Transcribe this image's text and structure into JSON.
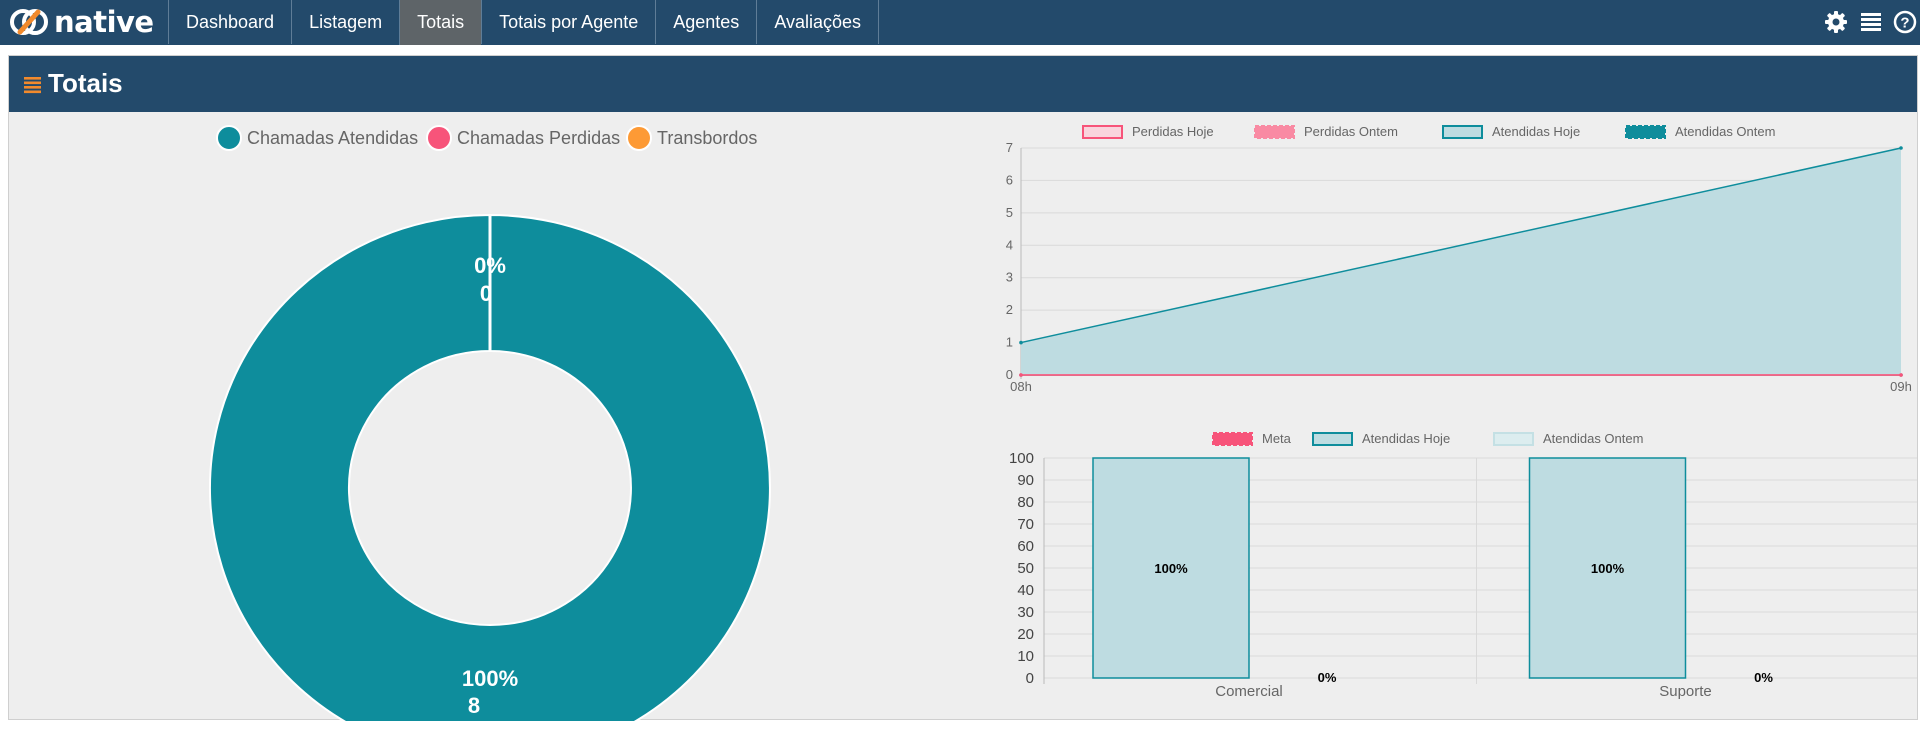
{
  "brand": {
    "name": "native"
  },
  "nav": {
    "items": [
      {
        "label": "Dashboard"
      },
      {
        "label": "Listagem"
      },
      {
        "label": "Totais"
      },
      {
        "label": "Totais por Agente"
      },
      {
        "label": "Agentes"
      },
      {
        "label": "Avaliações"
      }
    ],
    "active_index": 2
  },
  "toolbar": {
    "icons": [
      "gear-icon",
      "list-icon",
      "help-icon"
    ]
  },
  "panel": {
    "title": "Totais",
    "title_icon": "list-icon"
  },
  "colors": {
    "header_bg": "#234a6b",
    "atendidas": "#0e8d9c",
    "perdidas": "#f7547a",
    "transbordos": "#fd9a35",
    "area_fill": "#bedce1",
    "panel_bg": "#eeeeee"
  },
  "chart_data": [
    {
      "type": "pie",
      "variant": "doughnut",
      "legend": [
        "Chamadas Atendidas",
        "Chamadas Perdidas",
        "Transbordos"
      ],
      "slices": [
        {
          "name": "Chamadas Atendidas",
          "value": 8,
          "pct_label": "100%",
          "count_label": "8"
        },
        {
          "name": "Chamadas Perdidas",
          "value": 0,
          "pct_label": "0%",
          "count_label": "0"
        },
        {
          "name": "Transbordos",
          "value": 0
        }
      ]
    },
    {
      "type": "area",
      "legend": [
        "Perdidas Hoje",
        "Perdidas Ontem",
        "Atendidas Hoje",
        "Atendidas Ontem"
      ],
      "categories": [
        "08h",
        "09h"
      ],
      "series": [
        {
          "name": "Perdidas Hoje",
          "values": [
            0,
            0
          ]
        },
        {
          "name": "Perdidas Ontem",
          "values": [
            0,
            0
          ]
        },
        {
          "name": "Atendidas Hoje",
          "values": [
            1,
            7
          ]
        },
        {
          "name": "Atendidas Ontem",
          "values": [
            0,
            0
          ]
        }
      ],
      "ylim": [
        0,
        7
      ],
      "yticks": [
        "0",
        "1",
        "2",
        "3",
        "4",
        "5",
        "6",
        "7"
      ],
      "grid": true,
      "legend_position": "top"
    },
    {
      "type": "bar",
      "legend": [
        "Meta",
        "Atendidas Hoje",
        "Atendidas Ontem"
      ],
      "categories": [
        "Comercial",
        "Suporte"
      ],
      "series": [
        {
          "name": "Atendidas Hoje",
          "values": [
            100,
            100
          ],
          "labels": [
            "100%",
            "100%"
          ]
        },
        {
          "name": "Atendidas Ontem",
          "values": [
            0,
            0
          ],
          "labels": [
            "0%",
            "0%"
          ]
        }
      ],
      "ylim": [
        0,
        100
      ],
      "yticks": [
        "0",
        "10",
        "20",
        "30",
        "40",
        "50",
        "60",
        "70",
        "80",
        "90",
        "100"
      ],
      "grid": true,
      "legend_position": "top"
    }
  ]
}
